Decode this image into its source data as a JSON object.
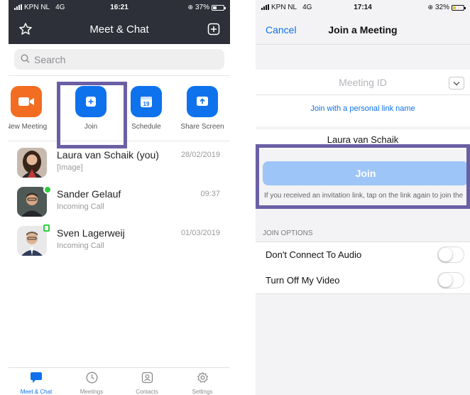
{
  "left_screen": {
    "status": {
      "carrier": "KPN NL",
      "network": "4G",
      "time": "16:21",
      "battery": "37%",
      "battery_level": 0.37
    },
    "header": {
      "title": "Meet & Chat",
      "left_icon": "star-icon",
      "right_icon": "plus-square-icon"
    },
    "search": {
      "placeholder": "Search"
    },
    "actions": [
      {
        "label": "New Meeting",
        "icon": "video-camera-icon",
        "color": "#f26d21"
      },
      {
        "label": "Join",
        "icon": "plus-icon",
        "color": "#0e72ed"
      },
      {
        "label": "Schedule",
        "icon": "calendar-icon",
        "icon_text": "19",
        "color": "#0e72ed"
      },
      {
        "label": "Share Screen",
        "icon": "upload-arrow-icon",
        "color": "#0e72ed"
      }
    ],
    "chats": [
      {
        "name": "Laura van Schaik (you)",
        "subtitle": "[Image]",
        "date": "28/02/2019"
      },
      {
        "name": "Sander Gelauf",
        "subtitle": "Incoming Call",
        "date": "09:37",
        "presence": "online"
      },
      {
        "name": "Sven Lagerweij",
        "subtitle": "Incoming Call",
        "date": "01/03/2019",
        "presence": "away"
      }
    ],
    "tabs": [
      {
        "label": "Meet & Chat",
        "icon": "chat-bubble-icon",
        "active": true
      },
      {
        "label": "Meetings",
        "icon": "clock-icon"
      },
      {
        "label": "Contacts",
        "icon": "contact-card-icon"
      },
      {
        "label": "Settings",
        "icon": "gear-icon"
      }
    ]
  },
  "right_screen": {
    "status": {
      "carrier": "KPN NL",
      "network": "4G",
      "time": "17:14",
      "battery": "32%",
      "battery_level": 0.32
    },
    "header": {
      "cancel": "Cancel",
      "title": "Join a Meeting"
    },
    "meeting_id": {
      "placeholder": "Meeting ID",
      "icon": "chevron-down-icon"
    },
    "personal_link": "Join with a personal link name",
    "display_name": "Laura van Schaik",
    "join_button": "Join",
    "note": "If you received an invitation link, tap on the link again to join the meeting",
    "join_options_header": "JOIN OPTIONS",
    "options": [
      {
        "label": "Don't Connect To Audio",
        "enabled": false
      },
      {
        "label": "Turn Off My Video",
        "enabled": false
      }
    ]
  },
  "highlight_color": "#6a5fa5",
  "accent_color": "#0e72ed"
}
